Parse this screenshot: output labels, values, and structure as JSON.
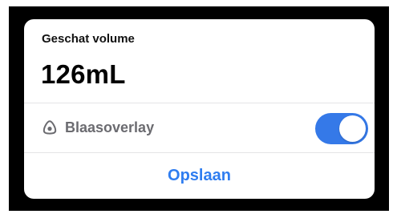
{
  "volume": {
    "label": "Geschat volume",
    "value": "126mL"
  },
  "overlay": {
    "icon": "bladder-icon",
    "label": "Blaasoverlay",
    "toggle_on": true
  },
  "actions": {
    "save_label": "Opslaan"
  },
  "colors": {
    "accent": "#2f7df0",
    "toggle_on": "#3579e8",
    "secondary_text": "#6b6b70"
  }
}
